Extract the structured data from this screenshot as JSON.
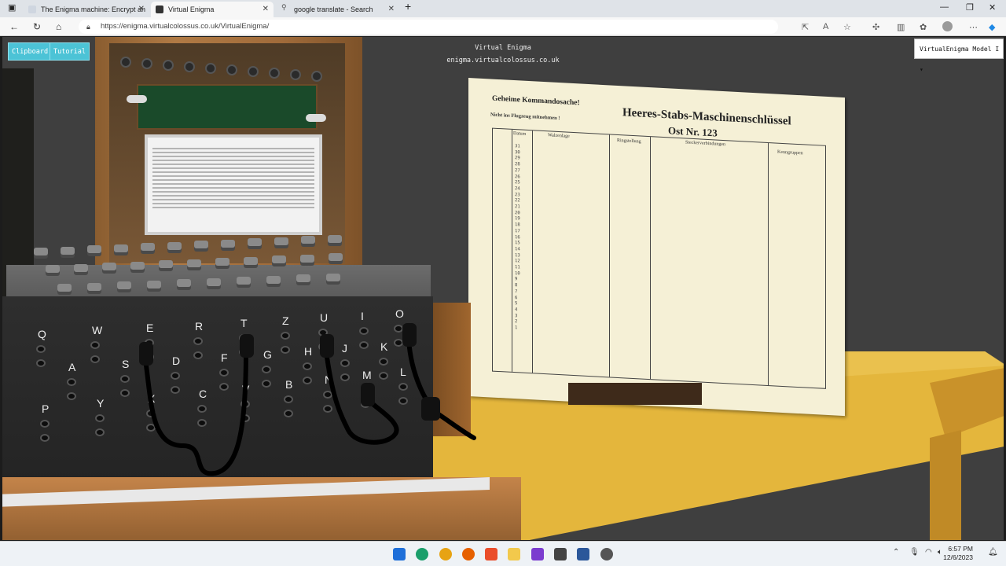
{
  "browser": {
    "tabs": [
      {
        "label": "The Enigma machine: Encrypt an",
        "active": false
      },
      {
        "label": "Virtual Enigma",
        "active": true
      },
      {
        "label": "google translate - Search",
        "active": false
      }
    ],
    "url": "https://enigma.virtualcolossus.co.uk/VirtualEnigma/"
  },
  "app": {
    "buttons": {
      "clipboard": "Clipboard",
      "tutorial": "Tutorial"
    },
    "title": "Virtual Enigma",
    "subtitle": "enigma.virtualcolossus.co.uk",
    "model_select": "VirtualEnigma Model I ▾"
  },
  "plugboard": {
    "row1": [
      "Q",
      "W",
      "E",
      "R",
      "T",
      "Z",
      "U",
      "I",
      "O"
    ],
    "row2": [
      "A",
      "S",
      "D",
      "F",
      "G",
      "H",
      "J",
      "K"
    ],
    "row3": [
      "P",
      "Y",
      "X",
      "C",
      "V",
      "B",
      "N",
      "M",
      "L"
    ]
  },
  "codebook": {
    "header_left": "Geheime Kommandosache!",
    "header_note": "Nicht ins Flugzeug mitnehmen !",
    "title": "Heeres-Stabs-Maschinenschlüssel",
    "subtitle": "Ost Nr. 123",
    "col_datum": "Datum",
    "col_walzenlage": "Walzenlage",
    "col_ringstellung": "Ringstellung",
    "col_stecker": "Steckerverbindungen",
    "col_kenngruppen": "Kenngruppen",
    "dates": [
      "31",
      "30",
      "29",
      "28",
      "27",
      "26",
      "25",
      "24",
      "23",
      "22",
      "21",
      "20",
      "19",
      "18",
      "17",
      "16",
      "15",
      "14",
      "13",
      "12",
      "11",
      "10",
      "9",
      "8",
      "7",
      "6",
      "5",
      "4",
      "3",
      "2",
      "1"
    ]
  },
  "taskbar": {
    "time": "6:57 PM",
    "date": "12/6/2023"
  }
}
